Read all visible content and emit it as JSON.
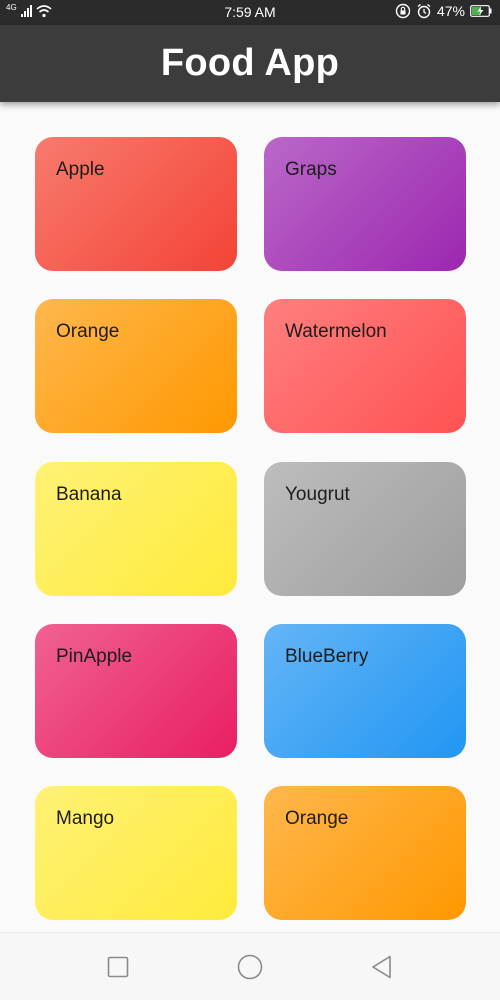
{
  "status_bar": {
    "network": "4G",
    "time": "7:59 AM",
    "battery": "47%",
    "icons": [
      "signal-icon",
      "wifi-icon",
      "rotation-lock-icon",
      "alarm-icon",
      "battery-charging-icon"
    ]
  },
  "app_bar": {
    "title": "Food App"
  },
  "cards": [
    {
      "label": "Apple",
      "color_start": "#f77b6e",
      "color_end": "#f44336"
    },
    {
      "label": "Graps",
      "color_start": "#ba68c8",
      "color_end": "#9c27b0"
    },
    {
      "label": "Orange",
      "color_start": "#ffb74d",
      "color_end": "#ff9800"
    },
    {
      "label": "Watermelon",
      "color_start": "#ff7f7f",
      "color_end": "#ff5252"
    },
    {
      "label": "Banana",
      "color_start": "#fff176",
      "color_end": "#ffeb3b"
    },
    {
      "label": "Yougrut",
      "color_start": "#bdbdbd",
      "color_end": "#9e9e9e"
    },
    {
      "label": "PinApple",
      "color_start": "#f06292",
      "color_end": "#e91e63"
    },
    {
      "label": "BlueBerry",
      "color_start": "#64b5f6",
      "color_end": "#2196f3"
    },
    {
      "label": "Mango",
      "color_start": "#fff176",
      "color_end": "#ffeb3b"
    },
    {
      "label": "Orange",
      "color_start": "#ffb74d",
      "color_end": "#ff9800"
    }
  ],
  "nav_bar": {
    "icons": [
      "recent-apps-icon",
      "home-icon",
      "back-icon"
    ]
  }
}
